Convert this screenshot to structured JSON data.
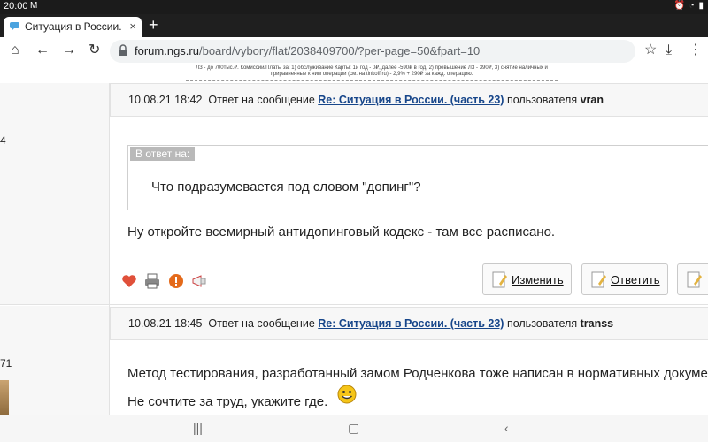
{
  "status_bar": {
    "time": "20:00",
    "left_icon": "gmail-icon",
    "right_icons": "battery-wifi-alarm"
  },
  "tab": {
    "title": "Ситуация в России. (",
    "close": "×",
    "new_tab": "+"
  },
  "toolbar": {
    "host": "forum.ngs.ru",
    "path": "/board/vybory/flat/2038409700/?per-page=50&fpart=10"
  },
  "ad_text": "ЛЗ - до 700тыс.₽. Комиссии/Платы за: 1) обслуживание Карты: 1й год - 0₽, далее -590₽ в год, 2) превышение ЛЗ - 390₽, 3) снятие наличных и приравненные к ним операции (см. на tinkoff.ru) - 2,9% + 290₽ за кажд. операцию.",
  "posts": [
    {
      "left_num": "4",
      "date": "10.08.21 18:42",
      "reply_prefix": "Ответ на сообщение",
      "thread_link": "Re: Ситуация в России. (часть 23)",
      "user_prefix": "пользователя",
      "user": "vran",
      "quote_label": "В ответ на:",
      "quote_text": "Что подразумевается под словом \"допинг\"?",
      "body": "Ну откройте всемирный антидопинговый кодекс - там все расписано.",
      "buttons": {
        "edit": "Изменить",
        "reply": "Ответить"
      }
    },
    {
      "left_num": "71",
      "date": "10.08.21 18:45",
      "reply_prefix": "Ответ на сообщение",
      "thread_link": "Re: Ситуация в России. (часть 23)",
      "user_prefix": "пользователя",
      "user": "transs",
      "body_line1": "Метод тестирования, разработанный замом Родченкова тоже написан в нормативных докуме",
      "body_line2": "Не сочтите за труд, укажите где."
    }
  ],
  "colors": {
    "link": "#17468a",
    "header_bg": "#f7f7f7",
    "quote_label_bg": "#b9b9b9"
  }
}
